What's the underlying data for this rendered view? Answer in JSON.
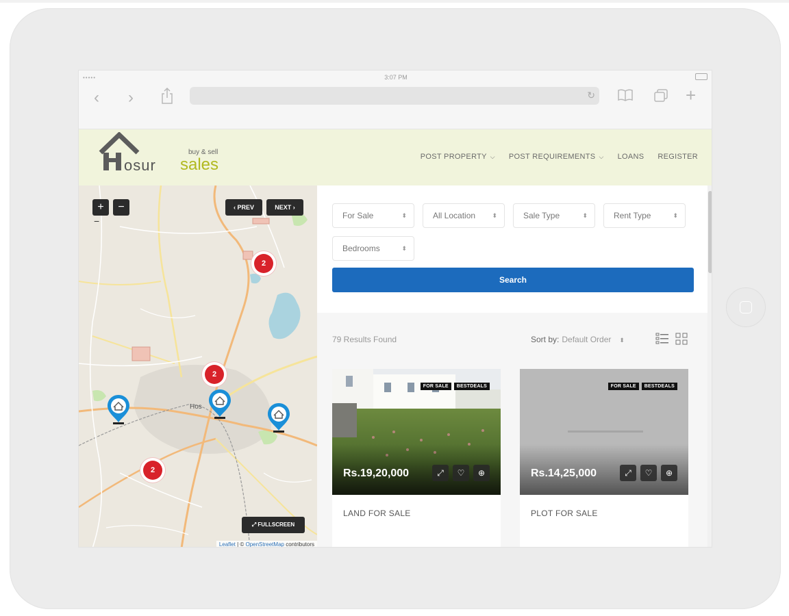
{
  "statusbar": {
    "time": "3:07 PM"
  },
  "site": {
    "logo": {
      "tagline": "buy & sell",
      "word1": "osur",
      "word2": "sales"
    },
    "menu": {
      "post_property": "POST PROPERTY",
      "post_requirements": "POST REQUIREMENTS",
      "loans": "LOANS",
      "register": "REGISTER"
    }
  },
  "map": {
    "zoom_in": "+",
    "zoom_out": "−",
    "minus_mark": "−",
    "prev": "PREV",
    "next": "NEXT",
    "fullscreen": "FULLSCREEN",
    "clusters": [
      "2",
      "2",
      "2"
    ],
    "town_label": "Hos",
    "attribution": {
      "leaflet": "Leaflet",
      "sep": " | © ",
      "osm": "OpenStreetMap",
      "rest": " contributors"
    }
  },
  "filters": {
    "for_sale": "For Sale",
    "all_location": "All Location",
    "sale_type": "Sale Type",
    "rent_type": "Rent Type",
    "bedrooms": "Bedrooms",
    "search": "Search"
  },
  "results": {
    "count_text": "79 Results Found",
    "sort_label": "Sort by:",
    "sort_value": "Default Order"
  },
  "listings": [
    {
      "badge1": "FOR SALE",
      "badge2": "BESTDEALS",
      "price": "Rs.19,20,000",
      "title": "LAND FOR SALE"
    },
    {
      "badge1": "FOR SALE",
      "badge2": "BESTDEALS",
      "price": "Rs.14,25,000",
      "title": "PLOT FOR SALE"
    }
  ],
  "colors": {
    "accent": "#1c6bbd",
    "cluster": "#d8222a",
    "header_bg": "#f1f4dc",
    "logo_green": "#b1b920"
  }
}
